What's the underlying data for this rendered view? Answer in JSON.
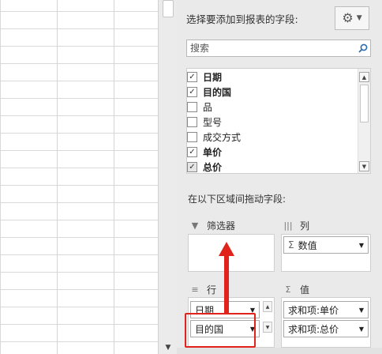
{
  "panel": {
    "title": "选择要添加到报表的字段:",
    "search_placeholder": "搜索",
    "fields": [
      {
        "label": "日期",
        "checked": true,
        "bold": true
      },
      {
        "label": "目的国",
        "checked": true,
        "bold": true
      },
      {
        "label": "品",
        "checked": false,
        "bold": false
      },
      {
        "label": "型号",
        "checked": false,
        "bold": false
      },
      {
        "label": "成交方式",
        "checked": false,
        "bold": false
      },
      {
        "label": "单价",
        "checked": true,
        "bold": true
      },
      {
        "label": "总价",
        "checked": true,
        "bold": true
      }
    ],
    "drag_label": "在以下区域间拖动字段:",
    "zones": {
      "filters": {
        "title": "筛选器"
      },
      "columns": {
        "title": "列",
        "items": [
          "数值"
        ]
      },
      "rows": {
        "title": "行",
        "items": [
          "日期",
          "目的国"
        ]
      },
      "values": {
        "title": "值",
        "items": [
          "求和项:单价",
          "求和项:总价"
        ]
      }
    }
  },
  "icons": {
    "gear": "gear-icon",
    "search": "search-icon",
    "filter": "filter-icon",
    "columns": "columns-icon",
    "rows": "rows-icon",
    "sigma": "sigma-icon"
  },
  "colors": {
    "annotation": "#e0231b",
    "panel_bg": "#eaeaea",
    "search_icon": "#2b6cb0"
  }
}
